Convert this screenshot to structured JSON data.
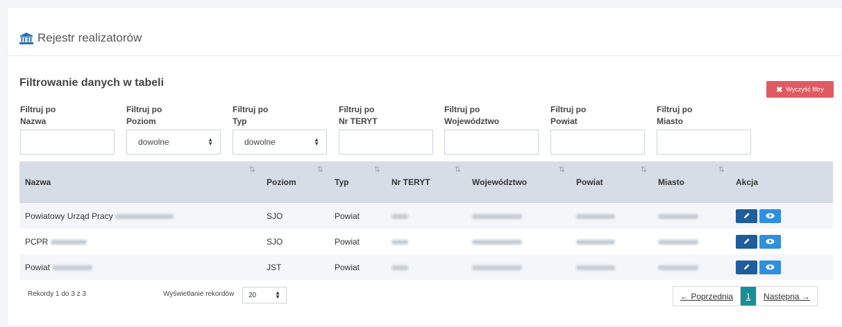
{
  "header": {
    "title": "Rejestr realizatorów",
    "icon": "bank-icon"
  },
  "filters": {
    "section_title": "Filtrowanie danych w tabeli",
    "clear_label": "Wyczyść filtry",
    "clear_color": "#e05a62",
    "fields": [
      {
        "line1": "Filtruj po",
        "line2": "Nazwa",
        "type": "text",
        "value": ""
      },
      {
        "line1": "Filtruj po",
        "line2": "Poziom",
        "type": "select",
        "value": "dowolne"
      },
      {
        "line1": "Filtruj po",
        "line2": "Typ",
        "type": "select",
        "value": "dowolne"
      },
      {
        "line1": "Filtruj po",
        "line2": "Nr TERYT",
        "type": "text",
        "value": ""
      },
      {
        "line1": "Filtruj po",
        "line2": "Województwo",
        "type": "text",
        "value": ""
      },
      {
        "line1": "Filtruj po",
        "line2": "Powiat",
        "type": "text",
        "value": ""
      },
      {
        "line1": "Filtruj po",
        "line2": "Miasto",
        "type": "text",
        "value": ""
      }
    ]
  },
  "table": {
    "columns": [
      "Nazwa",
      "Poziom",
      "Typ",
      "Nr TERYT",
      "Województwo",
      "Powiat",
      "Miasto",
      "Akcja"
    ],
    "rows": [
      {
        "nazwa": "Powiatowy Urząd Pracy",
        "poziom": "SJO",
        "typ": "Powiat"
      },
      {
        "nazwa": "PCPR",
        "poziom": "SJO",
        "typ": "Powiat"
      },
      {
        "nazwa": "Powiat",
        "poziom": "JST",
        "typ": "Powiat"
      }
    ]
  },
  "footer": {
    "records_info": "Rekordy 1 do 3 z 3",
    "page_size_label": "Wyświetlanie rekordów",
    "page_size": "20",
    "prev": "← Poprzednia",
    "current_page": "1",
    "next": "Następna →"
  },
  "colors": {
    "header_bg": "#d6dde6",
    "edit": "#1f5d9c",
    "view": "#2f8fe0",
    "active_page": "#1b8f95"
  }
}
